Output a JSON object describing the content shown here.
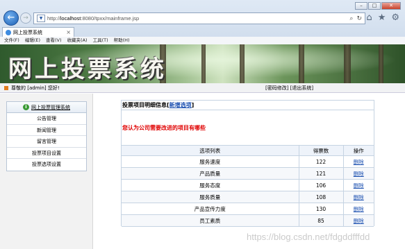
{
  "browser": {
    "url_prefix": "http://",
    "url_host": "localhost",
    "url_rest": ":8080/tpxx/mainframe.jsp",
    "tab_title": "网上投票系统",
    "tab_close": "×",
    "menu": [
      "文件(F)",
      "编辑(E)",
      "查看(V)",
      "收藏夹(A)",
      "工具(T)",
      "帮助(H)"
    ]
  },
  "banner": {
    "title": "网上投票系统"
  },
  "status": {
    "welcome": "尊敬的 [admin] 您好!",
    "links": "[密码修改] [退出系统]"
  },
  "sidebar": {
    "header": "网上投票管理系统",
    "items": [
      "公告管理",
      "新闻管理",
      "留言管理",
      "投票项目设置",
      "投票选项设置"
    ]
  },
  "main": {
    "heading": "投票项目明细信息[",
    "add_link": "新增选项",
    "heading_end": "]",
    "question": "您认为公司需要改进的项目有哪些",
    "columns": [
      "选项列表",
      "得票数",
      "操作"
    ],
    "rows": [
      {
        "name": "服务速度",
        "votes": "122",
        "action": "删除"
      },
      {
        "name": "产品质量",
        "votes": "121",
        "action": "删除"
      },
      {
        "name": "服务态度",
        "votes": "106",
        "action": "删除"
      },
      {
        "name": "服务质量",
        "votes": "108",
        "action": "删除"
      },
      {
        "name": "产品宣传力度",
        "votes": "130",
        "action": "删除"
      },
      {
        "name": "员工素质",
        "votes": "85",
        "action": "删除"
      }
    ]
  },
  "watermark": "https://blog.csdn.net/fdgddfffdd"
}
